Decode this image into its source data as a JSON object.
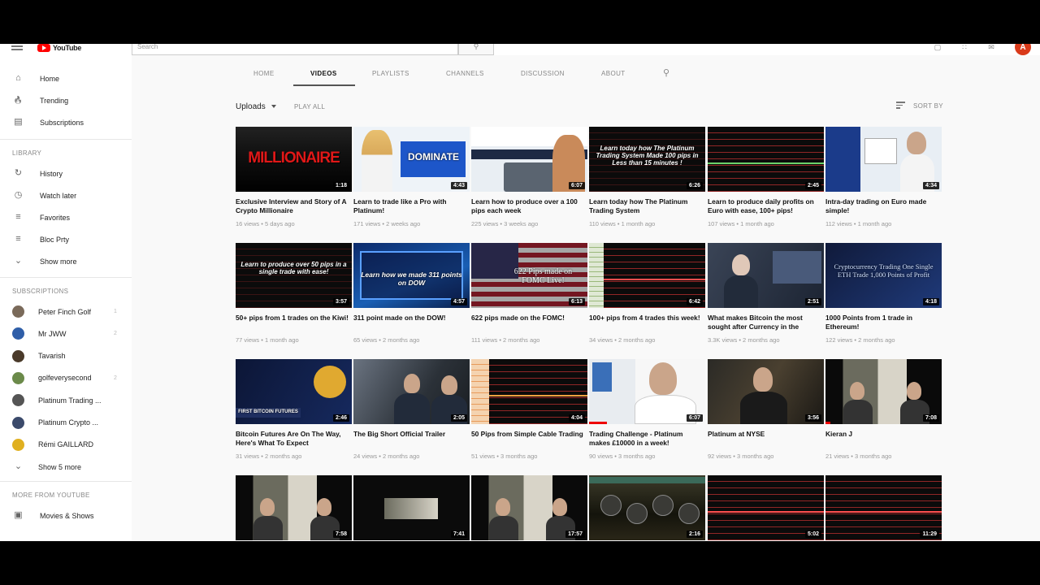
{
  "masthead": {
    "logo_text": "YouTube",
    "search_placeholder": "Search",
    "avatar_letter": "A"
  },
  "sidebar": {
    "nav": [
      {
        "label": "Home",
        "icon": "home-icon"
      },
      {
        "label": "Trending",
        "icon": "fire-icon"
      },
      {
        "label": "Subscriptions",
        "icon": "subscriptions-icon"
      }
    ],
    "library_heading": "LIBRARY",
    "library": [
      {
        "label": "History",
        "icon": "history-icon"
      },
      {
        "label": "Watch later",
        "icon": "clock-icon"
      },
      {
        "label": "Favorites",
        "icon": "playlist-icon"
      },
      {
        "label": "Bloc Prty",
        "icon": "playlist-icon"
      },
      {
        "label": "Show more",
        "icon": "chevron-down-icon"
      }
    ],
    "subscriptions_heading": "SUBSCRIPTIONS",
    "subscriptions": [
      {
        "label": "Peter Finch Golf",
        "count": "1",
        "color": "#7a6a5a"
      },
      {
        "label": "Mr JWW",
        "count": "2",
        "color": "#2f5ea8"
      },
      {
        "label": "Tavarish",
        "count": "",
        "color": "#4a3a2a"
      },
      {
        "label": "golfeverysecond",
        "count": "2",
        "color": "#6b8a4a"
      },
      {
        "label": "Platinum Trading ...",
        "count": "",
        "color": "#555"
      },
      {
        "label": "Platinum Crypto ...",
        "count": "",
        "color": "#3b4a6b"
      },
      {
        "label": "Rémi GAILLARD",
        "count": "",
        "color": "#e0b020"
      },
      {
        "label": "Show 5 more",
        "count": "",
        "color": ""
      }
    ],
    "more_heading": "MORE FROM YOUTUBE",
    "more": [
      {
        "label": "Movies & Shows",
        "icon": "film-icon"
      }
    ]
  },
  "tabs": [
    "HOME",
    "VIDEOS",
    "PLAYLISTS",
    "CHANNELS",
    "DISCUSSION",
    "ABOUT"
  ],
  "active_tab": "VIDEOS",
  "uploads": {
    "label": "Uploads",
    "play_all": "PLAY ALL",
    "sort_by": "SORT BY"
  },
  "videos": [
    {
      "title": "Exclusive Interview and Story of A Crypto Millionaire",
      "meta": "16 views • 5 days ago",
      "duration": "1:18",
      "thumb_text": "MILLIONAIRE",
      "style": "millionaire"
    },
    {
      "title": "Learn to trade like a Pro with Platinum!",
      "meta": "171 views • 2 weeks ago",
      "duration": "4:43",
      "thumb_text": "DOMINATE",
      "style": "dominate"
    },
    {
      "title": "Learn how to produce over a 100 pips each week",
      "meta": "225 views • 3 weeks ago",
      "duration": "6:07",
      "thumb_text": "",
      "style": "laptop"
    },
    {
      "title": "Learn today how The Platinum Trading System",
      "meta": "110 views • 1 month ago",
      "duration": "6:26",
      "thumb_text": "Learn today how The Platinum Trading System Made 100 pips in Less than 15 minutes !",
      "style": "dark-text"
    },
    {
      "title": "Learn to produce daily profits on Euro with ease, 100+ pips!",
      "meta": "107 views • 1 month ago",
      "duration": "2:45",
      "thumb_text": "",
      "style": "chart-green"
    },
    {
      "title": "Intra-day trading on Euro made simple!",
      "meta": "112 views • 1 month ago",
      "duration": "4:34",
      "thumb_text": "",
      "style": "office-white"
    },
    {
      "title": "50+ pips from 1 trades on the Kiwi!",
      "meta": "77 views • 1 month ago",
      "duration": "3:57",
      "thumb_text": "Learn to produce over 50 pips in a single trade with ease!",
      "style": "dark-text"
    },
    {
      "title": "311 point made on the DOW!",
      "meta": "65 views • 2 months ago",
      "duration": "4:57",
      "thumb_text": "Learn how we made 311 points on DOW",
      "style": "blue-text"
    },
    {
      "title": "622 pips made on the FOMC!",
      "meta": "111 views • 2 months ago",
      "duration": "6:13",
      "thumb_text": "622 Pips made on FOMC Live!",
      "style": "flag"
    },
    {
      "title": "100+ pips from 4 trades this week!",
      "meta": "34 views • 2 months ago",
      "duration": "6:42",
      "thumb_text": "",
      "style": "chart-red"
    },
    {
      "title": "What makes Bitcoin the most sought after Currency in the",
      "meta": "3.3K views • 2 months ago",
      "duration": "2:51",
      "thumb_text": "",
      "style": "studio"
    },
    {
      "title": "1000 Points from 1 trade in Ethereum!",
      "meta": "122 views • 2 months ago",
      "duration": "4:18",
      "thumb_text": "Cryptocurrency Trading One Single ETH Trade 1,000 Points of Profit",
      "style": "navy-text"
    },
    {
      "title": "Bitcoin Futures Are On The Way, Here's What To Expect",
      "meta": "31 views • 2 months ago",
      "duration": "2:46",
      "thumb_text": "FIRST BITCOIN FUTURES",
      "style": "bitcoin"
    },
    {
      "title": "The Big Short Official Trailer",
      "meta": "24 views • 2 months ago",
      "duration": "2:05",
      "thumb_text": "",
      "style": "office"
    },
    {
      "title": "50 Pips from Simple Cable Trading",
      "meta": "51 views • 3 months ago",
      "duration": "4:04",
      "thumb_text": "",
      "style": "chart-orange"
    },
    {
      "title": "Trading Challenge - Platinum makes £10000 in a week!",
      "meta": "90 views • 3 months ago",
      "duration": "6:07",
      "thumb_text": "",
      "style": "man-white"
    },
    {
      "title": "Platinum at NYSE",
      "meta": "92 views • 3 months ago",
      "duration": "3:56",
      "thumb_text": "",
      "style": "man-dark"
    },
    {
      "title": "Kieran J",
      "meta": "21 views • 3 months ago",
      "duration": "7:08",
      "thumb_text": "",
      "style": "room"
    },
    {
      "title": "",
      "meta": "",
      "duration": "7:58",
      "thumb_text": "",
      "style": "room"
    },
    {
      "title": "",
      "meta": "",
      "duration": "7:41",
      "thumb_text": "",
      "style": "small-frame"
    },
    {
      "title": "",
      "meta": "",
      "duration": "17:57",
      "thumb_text": "",
      "style": "room"
    },
    {
      "title": "",
      "meta": "",
      "duration": "2:16",
      "thumb_text": "",
      "style": "city"
    },
    {
      "title": "",
      "meta": "",
      "duration": "5:02",
      "thumb_text": "",
      "style": "chart-red"
    },
    {
      "title": "",
      "meta": "",
      "duration": "11:29",
      "thumb_text": "",
      "style": "chart-red"
    }
  ]
}
